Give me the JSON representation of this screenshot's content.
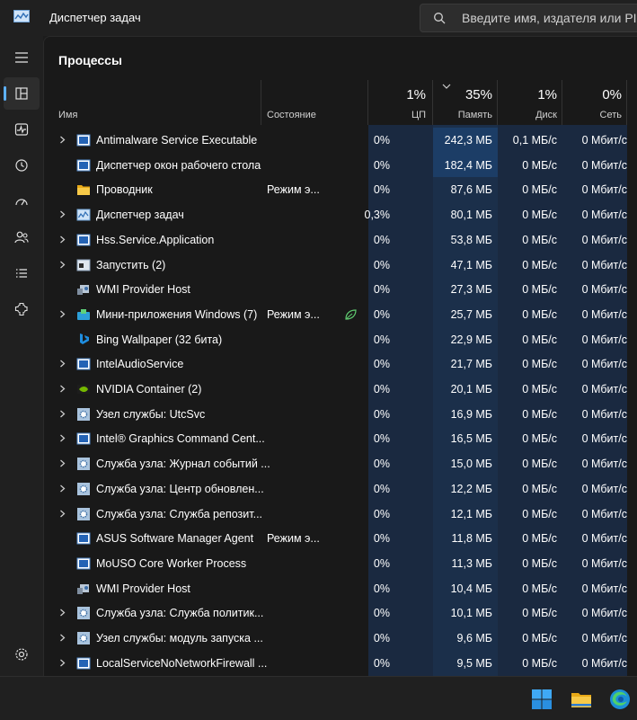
{
  "window": {
    "title": "Диспетчер задач"
  },
  "search": {
    "placeholder": "Введите имя, издателя или PID"
  },
  "page": {
    "title": "Процессы"
  },
  "columns": {
    "name": "Имя",
    "status": "Состояние",
    "cpu": {
      "label": "ЦП",
      "total": "1%"
    },
    "memory": {
      "label": "Память",
      "total": "35%"
    },
    "disk": {
      "label": "Диск",
      "total": "1%"
    },
    "network": {
      "label": "Сеть",
      "total": "0%"
    }
  },
  "colors": {
    "accent": "#5db1ff",
    "heat_low": "#1a2940",
    "heat_high": "#1c3d66"
  },
  "processes": [
    {
      "expandable": true,
      "icon": "window-icon",
      "name": "Antimalware Service Executable",
      "status": "",
      "eco": false,
      "cpu": "0%",
      "memory": "242,3 МБ",
      "disk": "0,1 МБ/с",
      "network": "0 Мбит/с",
      "mem_highlight": true
    },
    {
      "expandable": false,
      "icon": "window-icon",
      "name": "Диспетчер окон рабочего стола",
      "status": "",
      "eco": false,
      "cpu": "0%",
      "memory": "182,4 МБ",
      "disk": "0 МБ/с",
      "network": "0 Мбит/с",
      "mem_highlight": true
    },
    {
      "expandable": false,
      "icon": "folder-icon",
      "name": "Проводник",
      "status": "Режим э...",
      "eco": false,
      "cpu": "0%",
      "memory": "87,6 МБ",
      "disk": "0 МБ/с",
      "network": "0 Мбит/с",
      "mem_highlight": false
    },
    {
      "expandable": true,
      "icon": "taskmgr-icon",
      "name": "Диспетчер задач",
      "status": "",
      "eco": false,
      "cpu": "0,3%",
      "memory": "80,1 МБ",
      "disk": "0 МБ/с",
      "network": "0 Мбит/с",
      "mem_highlight": false
    },
    {
      "expandable": true,
      "icon": "window-icon",
      "name": "Hss.Service.Application",
      "status": "",
      "eco": false,
      "cpu": "0%",
      "memory": "53,8 МБ",
      "disk": "0 МБ/с",
      "network": "0 Мбит/с",
      "mem_highlight": false
    },
    {
      "expandable": true,
      "icon": "run-icon",
      "name": "Запустить (2)",
      "status": "",
      "eco": false,
      "cpu": "0%",
      "memory": "47,1 МБ",
      "disk": "0 МБ/с",
      "network": "0 Мбит/с",
      "mem_highlight": false
    },
    {
      "expandable": false,
      "icon": "wmi-icon",
      "name": "WMI Provider Host",
      "status": "",
      "eco": false,
      "cpu": "0%",
      "memory": "27,3 МБ",
      "disk": "0 МБ/с",
      "network": "0 Мбит/с",
      "mem_highlight": false
    },
    {
      "expandable": true,
      "icon": "widgets-icon",
      "name": "Мини-приложения Windows (7)",
      "status": "Режим э...",
      "eco": true,
      "cpu": "0%",
      "memory": "25,7 МБ",
      "disk": "0 МБ/с",
      "network": "0 Мбит/с",
      "mem_highlight": false
    },
    {
      "expandable": false,
      "icon": "bing-icon",
      "name": "Bing Wallpaper (32 бита)",
      "status": "",
      "eco": false,
      "cpu": "0%",
      "memory": "22,9 МБ",
      "disk": "0 МБ/с",
      "network": "0 Мбит/с",
      "mem_highlight": false
    },
    {
      "expandable": true,
      "icon": "window-icon",
      "name": "IntelAudioService",
      "status": "",
      "eco": false,
      "cpu": "0%",
      "memory": "21,7 МБ",
      "disk": "0 МБ/с",
      "network": "0 Мбит/с",
      "mem_highlight": false
    },
    {
      "expandable": true,
      "icon": "nvidia-icon",
      "name": "NVIDIA Container (2)",
      "status": "",
      "eco": false,
      "cpu": "0%",
      "memory": "20,1 МБ",
      "disk": "0 МБ/с",
      "network": "0 Мбит/с",
      "mem_highlight": false
    },
    {
      "expandable": true,
      "icon": "service-icon",
      "name": "Узел службы: UtcSvc",
      "status": "",
      "eco": false,
      "cpu": "0%",
      "memory": "16,9 МБ",
      "disk": "0 МБ/с",
      "network": "0 Мбит/с",
      "mem_highlight": false
    },
    {
      "expandable": true,
      "icon": "window-icon",
      "name": "Intel® Graphics Command Cent...",
      "status": "",
      "eco": false,
      "cpu": "0%",
      "memory": "16,5 МБ",
      "disk": "0 МБ/с",
      "network": "0 Мбит/с",
      "mem_highlight": false
    },
    {
      "expandable": true,
      "icon": "service-icon",
      "name": "Служба узла: Журнал событий ...",
      "status": "",
      "eco": false,
      "cpu": "0%",
      "memory": "15,0 МБ",
      "disk": "0 МБ/с",
      "network": "0 Мбит/с",
      "mem_highlight": false
    },
    {
      "expandable": true,
      "icon": "service-icon",
      "name": "Служба узла: Центр обновлен...",
      "status": "",
      "eco": false,
      "cpu": "0%",
      "memory": "12,2 МБ",
      "disk": "0 МБ/с",
      "network": "0 Мбит/с",
      "mem_highlight": false
    },
    {
      "expandable": true,
      "icon": "service-icon",
      "name": "Служба узла: Служба репозит...",
      "status": "",
      "eco": false,
      "cpu": "0%",
      "memory": "12,1 МБ",
      "disk": "0 МБ/с",
      "network": "0 Мбит/с",
      "mem_highlight": false
    },
    {
      "expandable": false,
      "icon": "window-icon",
      "name": "ASUS Software Manager Agent",
      "status": "Режим э...",
      "eco": false,
      "cpu": "0%",
      "memory": "11,8 МБ",
      "disk": "0 МБ/с",
      "network": "0 Мбит/с",
      "mem_highlight": false
    },
    {
      "expandable": false,
      "icon": "window-icon",
      "name": "MoUSO Core Worker Process",
      "status": "",
      "eco": false,
      "cpu": "0%",
      "memory": "11,3 МБ",
      "disk": "0 МБ/с",
      "network": "0 Мбит/с",
      "mem_highlight": false
    },
    {
      "expandable": false,
      "icon": "wmi-icon",
      "name": "WMI Provider Host",
      "status": "",
      "eco": false,
      "cpu": "0%",
      "memory": "10,4 МБ",
      "disk": "0 МБ/с",
      "network": "0 Мбит/с",
      "mem_highlight": false
    },
    {
      "expandable": true,
      "icon": "service-icon",
      "name": "Служба узла: Служба политик...",
      "status": "",
      "eco": false,
      "cpu": "0%",
      "memory": "10,1 МБ",
      "disk": "0 МБ/с",
      "network": "0 Мбит/с",
      "mem_highlight": false
    },
    {
      "expandable": true,
      "icon": "service-icon",
      "name": "Узел службы: модуль запуска ...",
      "status": "",
      "eco": false,
      "cpu": "0%",
      "memory": "9,6 МБ",
      "disk": "0 МБ/с",
      "network": "0 Мбит/с",
      "mem_highlight": false
    },
    {
      "expandable": true,
      "icon": "window-icon",
      "name": "LocalServiceNoNetworkFirewall ...",
      "status": "",
      "eco": false,
      "cpu": "0%",
      "memory": "9,5 МБ",
      "disk": "0 МБ/с",
      "network": "0 Мбит/с",
      "mem_highlight": false
    }
  ],
  "sidebar": {
    "items": [
      {
        "icon": "hamburger-icon"
      },
      {
        "icon": "processes-icon",
        "active": true
      },
      {
        "icon": "performance-icon"
      },
      {
        "icon": "app-history-icon"
      },
      {
        "icon": "startup-apps-icon"
      },
      {
        "icon": "users-icon"
      },
      {
        "icon": "details-icon"
      },
      {
        "icon": "services-icon"
      }
    ],
    "settings_icon": "gear-icon"
  },
  "taskbar": {
    "icons": [
      "windows-start-icon",
      "file-explorer-icon",
      "edge-icon"
    ]
  }
}
